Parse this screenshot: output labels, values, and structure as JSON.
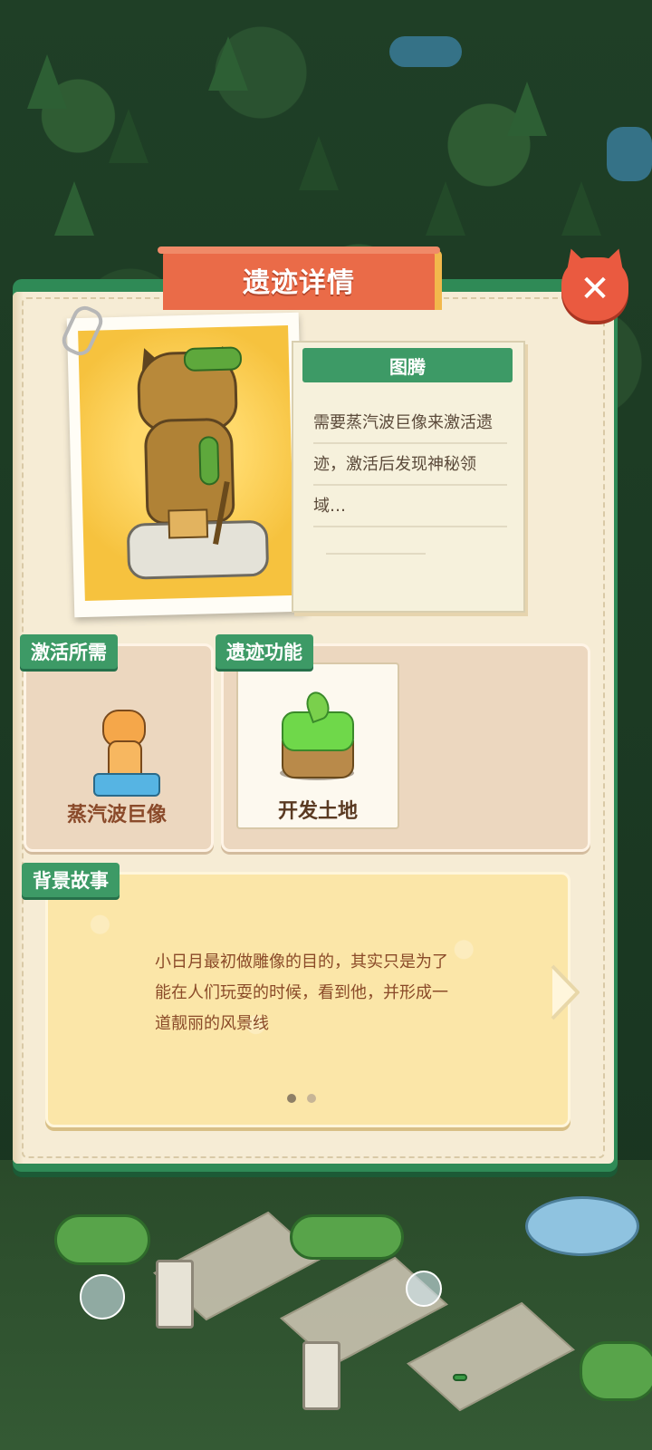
{
  "dialog": {
    "title": "遗迹详情",
    "close_symbol": "✕"
  },
  "relic": {
    "name": "图腾",
    "description": "需要蒸汽波巨像来激活遗迹，激活后发现神秘领域…"
  },
  "requirements": {
    "label": "激活所需",
    "item_name": "蒸汽波巨像"
  },
  "function": {
    "label": "遗迹功能",
    "item_name": "开发土地"
  },
  "story": {
    "label": "背景故事",
    "text": "小日月最初做雕像的目的，其实只是为了能在人们玩耍的时候，看到他，并形成一道靓丽的风景线",
    "pages": 2,
    "current_page": 1
  },
  "colors": {
    "panel_green": "#2f8a56",
    "label_green": "#3d9a66",
    "title_orange": "#ea6b48",
    "close_red": "#ea5a40",
    "text_brown": "#8a4a28"
  },
  "icons": [
    "paperclip-icon",
    "close-icon",
    "next-arrow-icon",
    "statue-illustration",
    "colossus-item-icon",
    "soil-block-icon"
  ]
}
